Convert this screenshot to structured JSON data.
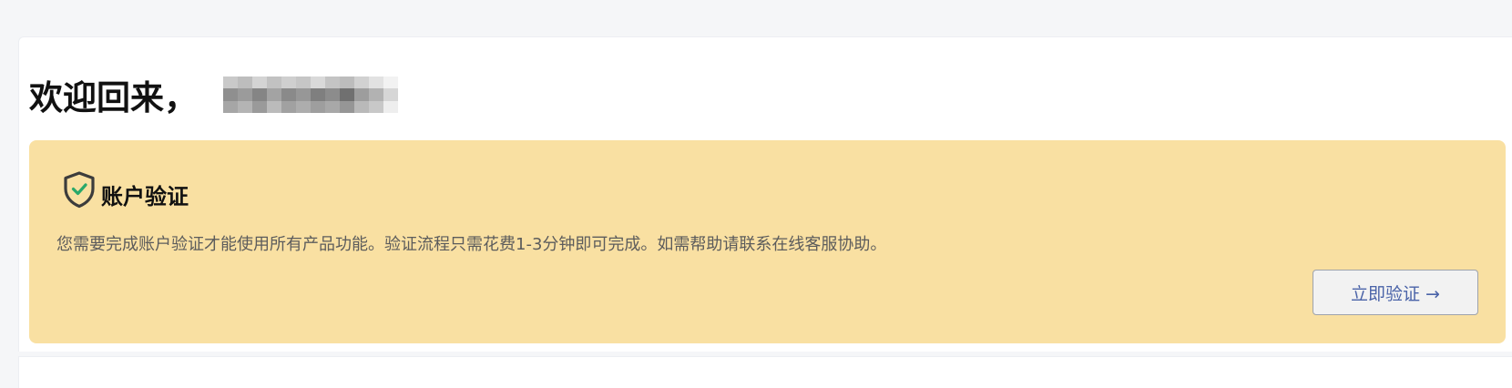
{
  "header": {
    "welcome": "欢迎回来，",
    "username_redacted": true
  },
  "verification_banner": {
    "icon": "shield-check-icon",
    "title": "账户验证",
    "description": "您需要完成账户验证才能使用所有产品功能。验证流程只需花费1-3分钟即可完成。如需帮助请联系在线客服协助。",
    "button_label": "立即验证 →",
    "background_color": "#f9e0a2",
    "check_color": "#2aa86a",
    "button_text_color": "#4a63a8"
  }
}
